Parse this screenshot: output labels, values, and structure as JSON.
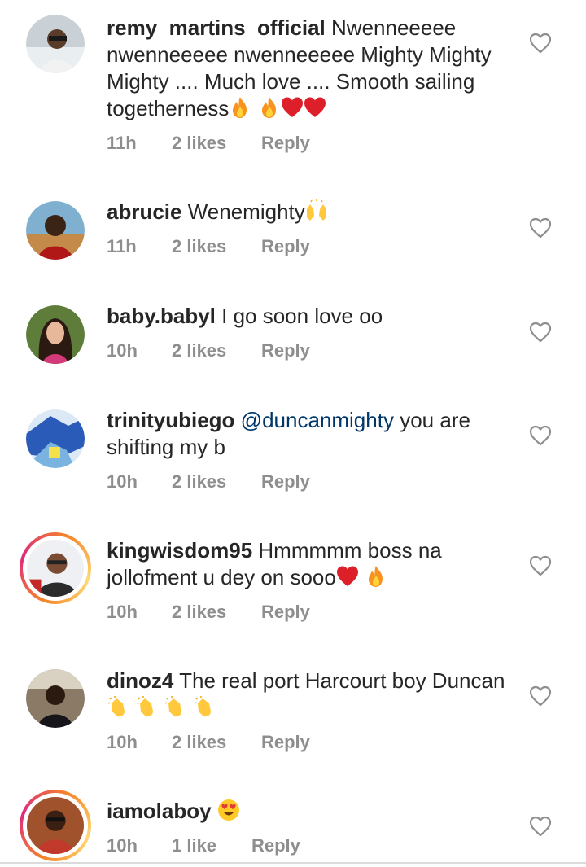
{
  "comments": [
    {
      "username": "remy_martins_official",
      "text_a": "Nwenneeeee nwenneeeee nwenneeeee Mighty Mighty Mighty .... Much love .... Smooth sailing togetherness",
      "time": "11h",
      "likes": "2 likes",
      "reply": "Reply"
    },
    {
      "username": "abrucie",
      "text_a": "Wenemighty",
      "time": "11h",
      "likes": "2 likes",
      "reply": "Reply"
    },
    {
      "username": "baby.babyl",
      "text_a": "I go soon love oo",
      "time": "10h",
      "likes": "2 likes",
      "reply": "Reply"
    },
    {
      "username": "trinityubiego",
      "mention": "@duncanmighty",
      "text_a": "you are shifting my b",
      "time": "10h",
      "likes": "2 likes",
      "reply": "Reply"
    },
    {
      "username": "kingwisdom95",
      "text_a": "Hmmmmm boss na jollofment u dey on sooo",
      "time": "10h",
      "likes": "2 likes",
      "reply": "Reply"
    },
    {
      "username": "dinoz4",
      "text_a": "The real port Harcourt boy Duncan",
      "time": "10h",
      "likes": "2 likes",
      "reply": "Reply"
    },
    {
      "username": "iamolaboy",
      "text_a": "",
      "time": "10h",
      "likes": "1 like",
      "reply": "Reply"
    }
  ],
  "icons": {
    "like": "heart-outline-icon",
    "fire": "fire-emoji",
    "red_heart": "red-heart-emoji",
    "raised_hands": "raising-hands-emoji",
    "clap": "clapping-hands-emoji",
    "heart_eyes": "heart-eyes-emoji"
  },
  "colors": {
    "text": "#262626",
    "meta": "#8e8e8e",
    "mention": "#00376b"
  }
}
